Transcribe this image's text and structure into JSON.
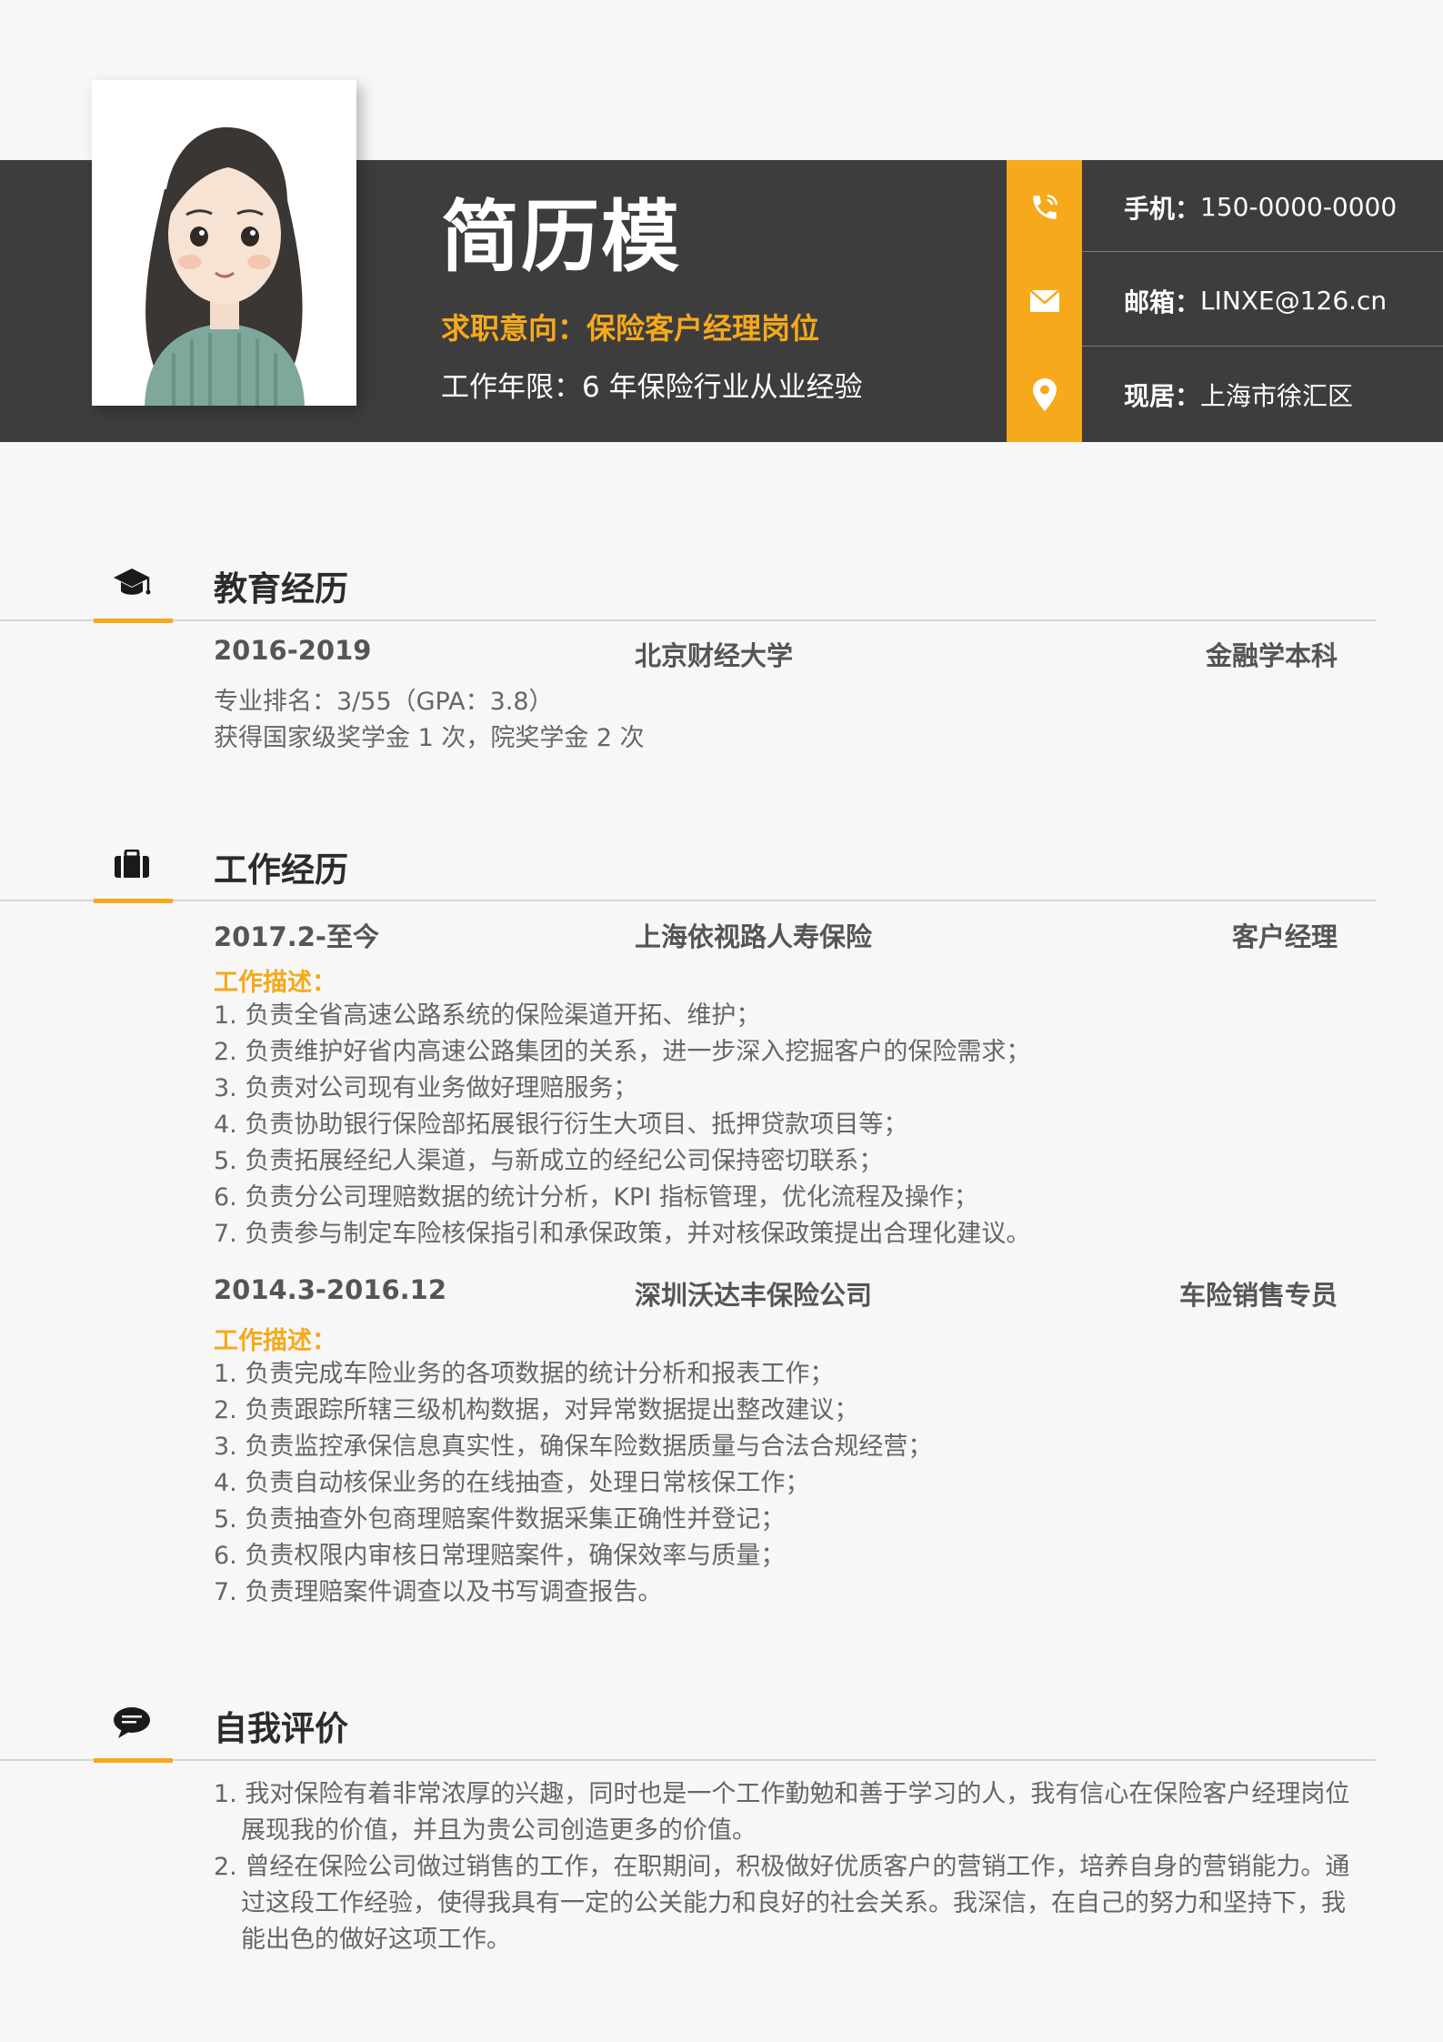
{
  "header": {
    "name": "简历模",
    "objective": "求职意向：保险客户经理岗位",
    "years": "工作年限：6 年保险行业从业经验"
  },
  "contact": {
    "phone_label": "手机：",
    "phone": "150-0000-0000",
    "email_label": "邮箱：",
    "email": "LINXE@126.cn",
    "address_label": "现居：",
    "address": "上海市徐汇区"
  },
  "education": {
    "title": "教育经历",
    "period": "2016-2019",
    "school": "北京财经大学",
    "degree": "金融学本科",
    "lines": [
      "专业排名：3/55（GPA：3.8）",
      "获得国家级奖学金 1 次，院奖学金 2 次"
    ]
  },
  "work": {
    "title": "工作经历",
    "jobs": [
      {
        "period": "2017.2-至今",
        "company": "上海依视路人寿保险",
        "role": "客户经理",
        "desc_label": "工作描述：",
        "items": [
          "1. 负责全省高速公路系统的保险渠道开拓、维护；",
          "2. 负责维护好省内高速公路集团的关系，进一步深入挖掘客户的保险需求；",
          "3. 负责对公司现有业务做好理赔服务；",
          "4. 负责协助银行保险部拓展银行衍生大项目、抵押贷款项目等；",
          "5. 负责拓展经纪人渠道，与新成立的经纪公司保持密切联系；",
          "6. 负责分公司理赔数据的统计分析，KPI 指标管理，优化流程及操作；",
          "7. 负责参与制定车险核保指引和承保政策，并对核保政策提出合理化建议。"
        ]
      },
      {
        "period": "2014.3-2016.12",
        "company": "深圳沃达丰保险公司",
        "role": "车险销售专员",
        "desc_label": "工作描述：",
        "items": [
          "1. 负责完成车险业务的各项数据的统计分析和报表工作；",
          "2. 负责跟踪所辖三级机构数据，对异常数据提出整改建议；",
          "3. 负责监控承保信息真实性，确保车险数据质量与合法合规经营；",
          "4. 负责自动核保业务的在线抽查，处理日常核保工作；",
          "5. 负责抽查外包商理赔案件数据采集正确性并登记；",
          "6. 负责权限内审核日常理赔案件，确保效率与质量；",
          "7. 负责理赔案件调查以及书写调查报告。"
        ]
      }
    ]
  },
  "evaluation": {
    "title": "自我评价",
    "items": [
      "1. 我对保险有着非常浓厚的兴趣，同时也是一个工作勤勉和善于学习的人，我有信心在保险客户经理岗位展现我的价值，并且为贵公司创造更多的价值。",
      "2. 曾经在保险公司做过销售的工作，在职期间，积极做好优质客户的营销工作，培养自身的营销能力。通过这段工作经验，使得我具有一定的公关能力和良好的社会关系。我深信，在自己的努力和坚持下，我能出色的做好这项工作。"
    ]
  },
  "colors": {
    "accent": "#f5a91b",
    "header_bg": "#3d3d3d",
    "page_bg": "#f7f7f7"
  },
  "icons": {
    "phone": "phone-icon",
    "email": "envelope-icon",
    "address": "location-pin-icon",
    "education": "graduation-cap-icon",
    "work": "briefcase-icon",
    "evaluation": "speech-bubble-icon"
  }
}
